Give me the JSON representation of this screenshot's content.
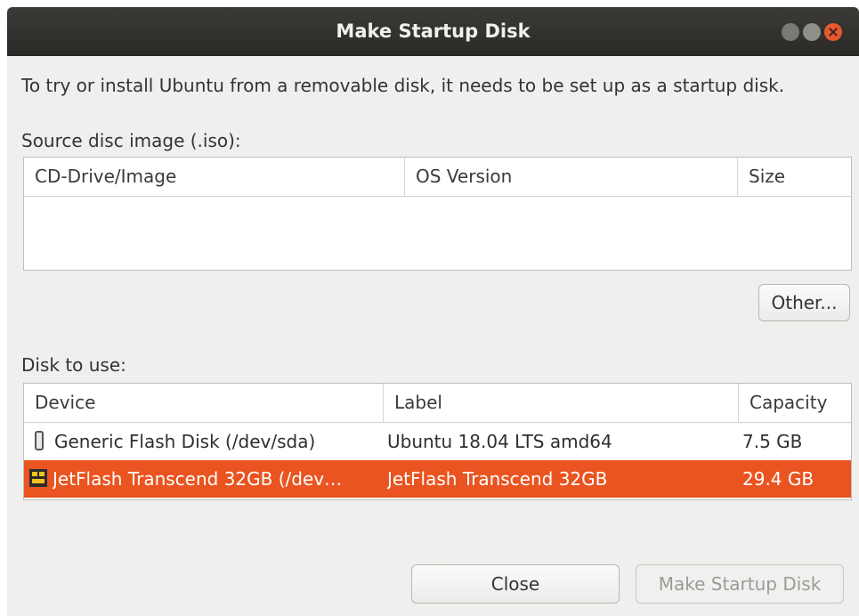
{
  "window": {
    "title": "Make Startup Disk"
  },
  "intro_text": "To try or install Ubuntu from a removable disk, it needs to be set up as a startup disk.",
  "source": {
    "label": "Source disc image (.iso):",
    "columns": [
      "CD-Drive/Image",
      "OS Version",
      "Size"
    ],
    "rows": [],
    "other_button": "Other..."
  },
  "disk": {
    "label": "Disk to use:",
    "columns": [
      "Device",
      "Label",
      "Capacity"
    ],
    "rows": [
      {
        "device": "Generic Flash Disk (/dev/sda)",
        "label": "Ubuntu 18.04 LTS amd64",
        "capacity": "7.5 GB",
        "icon": "usb-drive-icon",
        "selected": false
      },
      {
        "device": "JetFlash Transcend 32GB (/dev…",
        "label": "JetFlash Transcend 32GB",
        "capacity": "29.4 GB",
        "icon": "flash-drive-icon",
        "selected": true
      }
    ]
  },
  "buttons": {
    "close": "Close",
    "make_startup_disk": "Make Startup Disk"
  },
  "colors": {
    "selection": "#e95420",
    "titlebar": "#2f2e2b"
  }
}
